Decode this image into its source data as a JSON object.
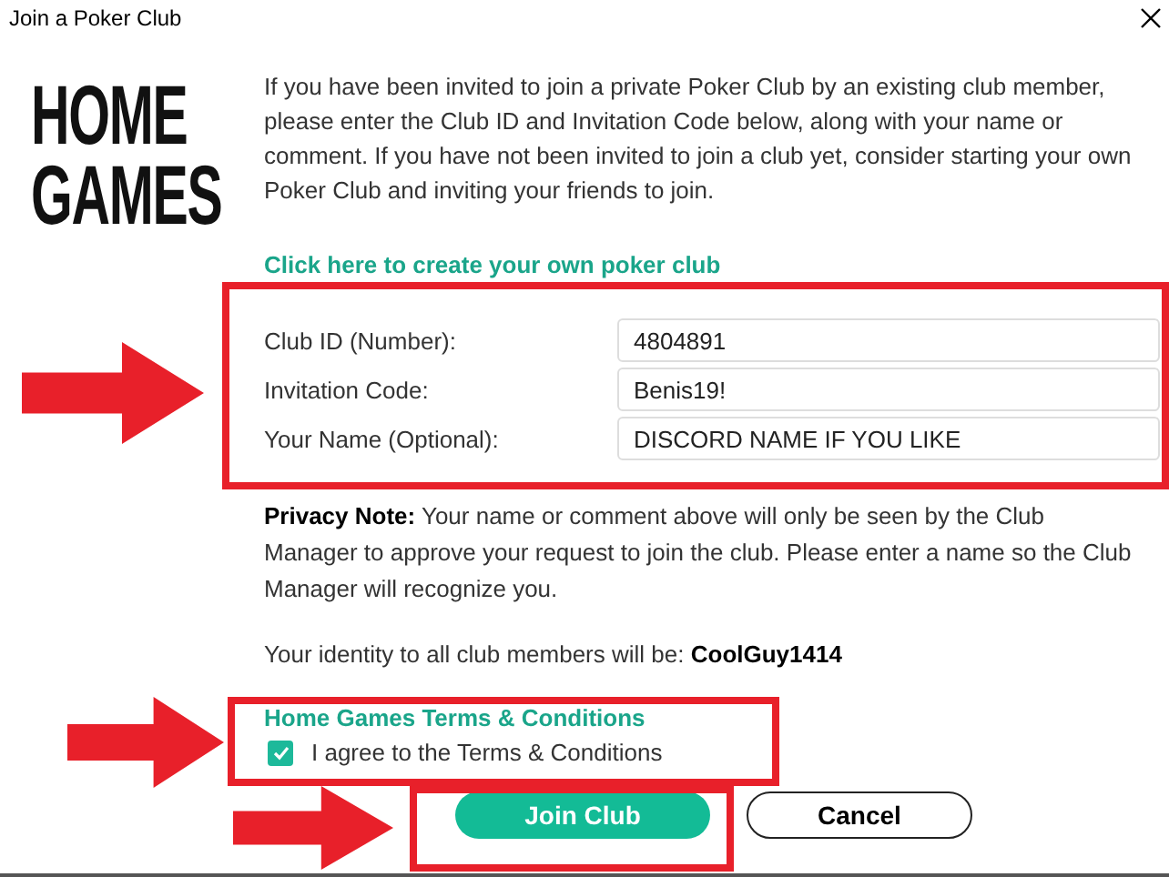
{
  "window": {
    "title": "Join a Poker Club"
  },
  "logo": [
    "HOME",
    "GAMES"
  ],
  "intro": "If you have been invited to join a private Poker Club by an existing club member, please enter the Club ID and Invitation Code below, along with your name or comment. If you have not been invited to join a club yet, consider starting your own Poker Club and inviting your friends to join.",
  "create_link": "Click here to create your own poker club",
  "fields": [
    {
      "label": "Club ID (Number):",
      "value": "4804891"
    },
    {
      "label": "Invitation Code:",
      "value": "Benis19!"
    },
    {
      "label": "Your Name (Optional):",
      "value": "DISCORD NAME IF YOU LIKE"
    }
  ],
  "privacy_note": "**Privacy Note:** Your name or comment above will only be seen by the Club Manager to approve your request to join the club. Please enter a name so the Club Manager will recognize you.",
  "identity": "Your identity to all club members will be: **CoolGuy1414**",
  "terms_link": "Home Games Terms & Conditions",
  "agree": {
    "label": "I agree to the Terms & Conditions",
    "checked": true
  },
  "buttons": [
    {
      "label": "Join Club",
      "kind": "primary"
    },
    {
      "label": "Cancel",
      "kind": "secondary"
    }
  ]
}
